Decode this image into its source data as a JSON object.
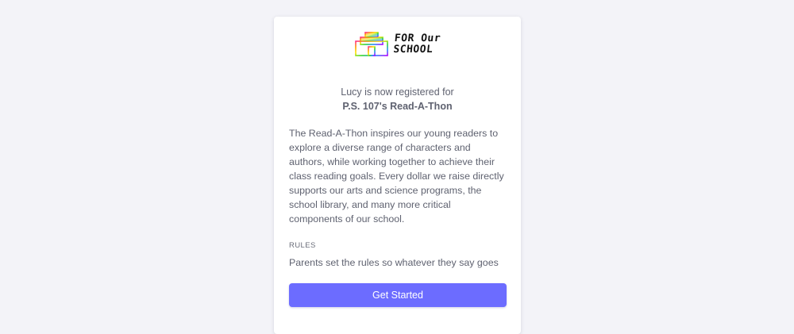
{
  "logo": {
    "line1": "FOR Our",
    "line2": "SCHOOL",
    "icon": "rainbow-school-building-icon"
  },
  "registration": {
    "message": "Lucy is now registered for",
    "event_name": "P.S. 107's Read-A-Thon"
  },
  "description": "The Read-A-Thon inspires our young readers to explore a diverse range of characters and authors, while working together to achieve their class reading goals. Every dollar we raise directly supports our arts and science programs, the school library, and many more critical components of our school.",
  "rules": {
    "heading": "RULES",
    "text": "Parents set the rules so whatever they say goes"
  },
  "cta": {
    "label": "Get Started"
  },
  "colors": {
    "background": "#f3f3f8",
    "card": "#ffffff",
    "text": "#5f6270",
    "button": "#6c6cff",
    "button_text": "#ffffff"
  }
}
